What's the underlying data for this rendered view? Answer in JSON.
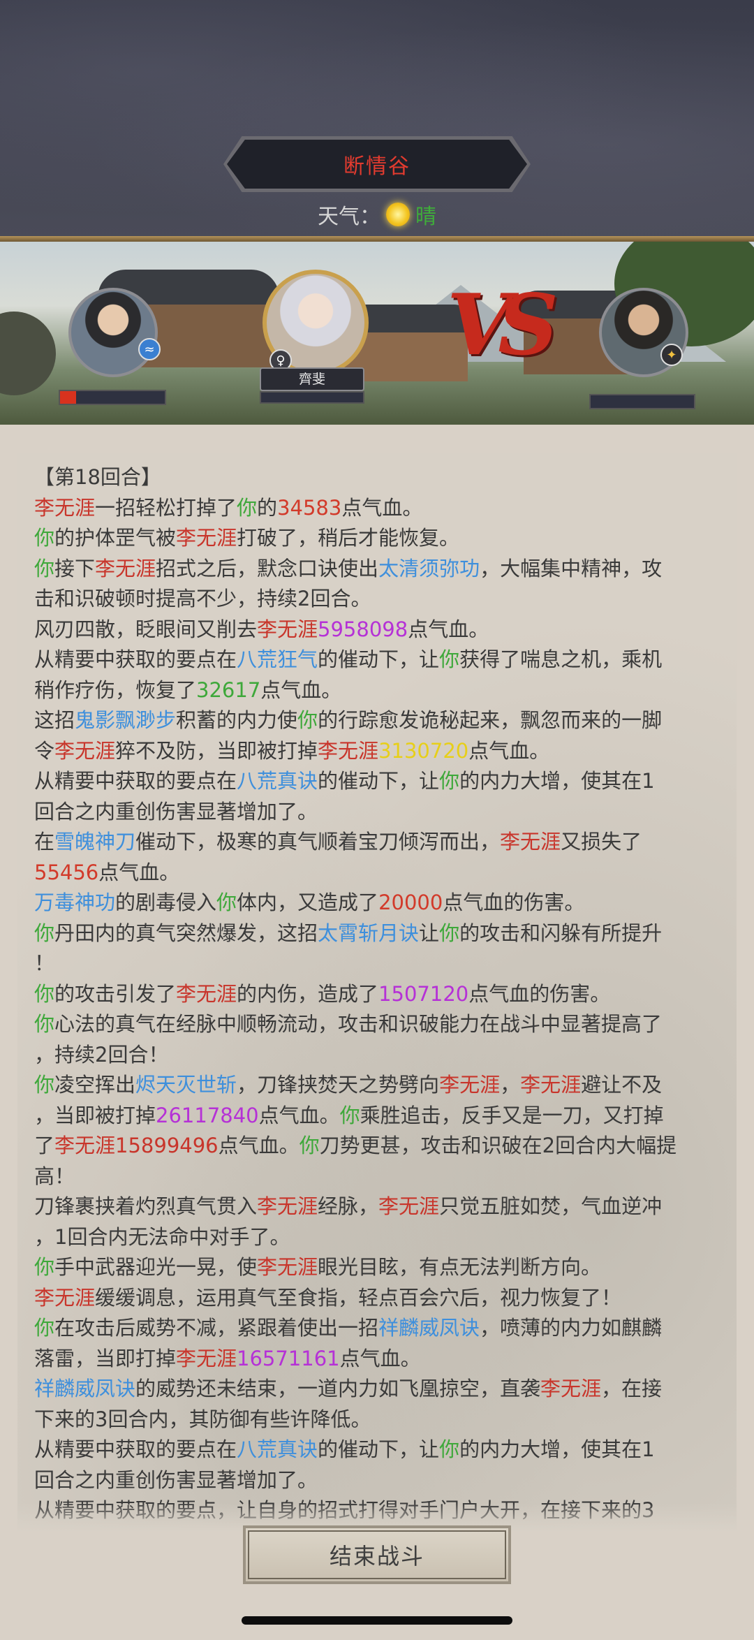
{
  "header": {
    "location_title": "断情谷",
    "weather_label": "天气：",
    "weather_icon": "sun-icon",
    "weather_value": "晴"
  },
  "battle": {
    "ally_name": "齊斐",
    "player_hp_fraction": 0.15,
    "ally_hp_fraction": 0.0,
    "enemy_hp_fraction": 0.0,
    "vs_text": "VS"
  },
  "colors": {
    "enemy": "#c8352b",
    "self": "#3ea83a",
    "skill": "#3e8fdc",
    "num_yellow": "#e7cf19",
    "num_purple": "#b531d6"
  },
  "log": [
    [
      [
        "default",
        "【第18回合】"
      ]
    ],
    [
      [
        "enemy",
        "李无涯"
      ],
      [
        "default",
        "一招轻松打掉了"
      ],
      [
        "self",
        "你"
      ],
      [
        "default",
        "的"
      ],
      [
        "num-red",
        "34583"
      ],
      [
        "default",
        "点气血。"
      ]
    ],
    [
      [
        "self",
        "你"
      ],
      [
        "default",
        "的护体罡气被"
      ],
      [
        "enemy",
        "李无涯"
      ],
      [
        "default",
        "打破了，稍后才能恢复。"
      ]
    ],
    [
      [
        "self",
        "你"
      ],
      [
        "default",
        "接下"
      ],
      [
        "enemy",
        "李无涯"
      ],
      [
        "default",
        "招式之后，默念口诀使出"
      ],
      [
        "skill",
        "太清须弥功"
      ],
      [
        "default",
        "，大幅集中精神，攻"
      ]
    ],
    [
      [
        "default",
        "击和识破顿时提高不少，持续2回合。"
      ]
    ],
    [
      [
        "default",
        "风刃四散，眨眼间又削去"
      ],
      [
        "enemy",
        "李无涯"
      ],
      [
        "num-purple",
        "5958098"
      ],
      [
        "default",
        "点气血。"
      ]
    ],
    [
      [
        "default",
        "从精要中获取的要点在"
      ],
      [
        "skill",
        "八荒狂气"
      ],
      [
        "default",
        "的催动下，让"
      ],
      [
        "self",
        "你"
      ],
      [
        "default",
        "获得了喘息之机，乘机"
      ]
    ],
    [
      [
        "default",
        "稍作疗伤，恢复了"
      ],
      [
        "num-green",
        "32617"
      ],
      [
        "default",
        "点气血。"
      ]
    ],
    [
      [
        "default",
        "这招"
      ],
      [
        "skill",
        "鬼影飘渺步"
      ],
      [
        "default",
        "积蓄的内力使"
      ],
      [
        "self",
        "你"
      ],
      [
        "default",
        "的行踪愈发诡秘起来，飘忽而来的一脚"
      ]
    ],
    [
      [
        "default",
        "令"
      ],
      [
        "enemy",
        "李无涯"
      ],
      [
        "default",
        "猝不及防，当即被打掉"
      ],
      [
        "enemy",
        "李无涯"
      ],
      [
        "num-yellow",
        "3130720"
      ],
      [
        "default",
        "点气血。"
      ]
    ],
    [
      [
        "default",
        "从精要中获取的要点在"
      ],
      [
        "skill",
        "八荒真诀"
      ],
      [
        "default",
        "的催动下，让"
      ],
      [
        "self",
        "你"
      ],
      [
        "default",
        "的内力大增，使其在1"
      ]
    ],
    [
      [
        "default",
        "回合之内重创伤害显著增加了。"
      ]
    ],
    [
      [
        "default",
        "在"
      ],
      [
        "skill",
        "雪魄神刀"
      ],
      [
        "default",
        "催动下，极寒的真气顺着宝刀倾泻而出，"
      ],
      [
        "enemy",
        "李无涯"
      ],
      [
        "default",
        "又损失了"
      ]
    ],
    [
      [
        "num-red",
        "55456"
      ],
      [
        "default",
        "点气血。"
      ]
    ],
    [
      [
        "skill",
        "万毒神功"
      ],
      [
        "default",
        "的剧毒侵入"
      ],
      [
        "self",
        "你"
      ],
      [
        "default",
        "体内，又造成了"
      ],
      [
        "num-red",
        "20000"
      ],
      [
        "default",
        "点气血的伤害。"
      ]
    ],
    [
      [
        "self",
        "你"
      ],
      [
        "default",
        "丹田内的真气突然爆发，这招"
      ],
      [
        "skill",
        "太霄斩月诀"
      ],
      [
        "default",
        "让"
      ],
      [
        "self",
        "你"
      ],
      [
        "default",
        "的攻击和闪躲有所提升"
      ]
    ],
    [
      [
        "default",
        "！"
      ]
    ],
    [
      [
        "self",
        "你"
      ],
      [
        "default",
        "的攻击引发了"
      ],
      [
        "enemy",
        "李无涯"
      ],
      [
        "default",
        "的内伤，造成了"
      ],
      [
        "num-purple",
        "1507120"
      ],
      [
        "default",
        "点气血的伤害。"
      ]
    ],
    [
      [
        "self",
        "你"
      ],
      [
        "default",
        "心法的真气在经脉中顺畅流动，攻击和识破能力在战斗中显著提高了"
      ]
    ],
    [
      [
        "default",
        "，持续2回合！"
      ]
    ],
    [
      [
        "self",
        "你"
      ],
      [
        "default",
        "凌空挥出"
      ],
      [
        "skill",
        "烬天灭世斩"
      ],
      [
        "default",
        "，刀锋挟焚天之势劈向"
      ],
      [
        "enemy",
        "李无涯"
      ],
      [
        "default",
        "，"
      ],
      [
        "enemy",
        "李无涯"
      ],
      [
        "default",
        "避让不及"
      ]
    ],
    [
      [
        "default",
        "，当即被打掉"
      ],
      [
        "num-purple",
        "26117840"
      ],
      [
        "default",
        "点气血。"
      ],
      [
        "self",
        "你"
      ],
      [
        "default",
        "乘胜追击，反手又是一刀，又打掉"
      ]
    ],
    [
      [
        "default",
        "了"
      ],
      [
        "enemy",
        "李无涯15899496"
      ],
      [
        "default",
        "点气血。"
      ],
      [
        "self",
        "你"
      ],
      [
        "default",
        "刀势更甚，攻击和识破在2回合内大幅提"
      ]
    ],
    [
      [
        "default",
        "高！"
      ]
    ],
    [
      [
        "default",
        "刀锋裹挟着灼烈真气贯入"
      ],
      [
        "enemy",
        "李无涯"
      ],
      [
        "default",
        "经脉，"
      ],
      [
        "enemy",
        "李无涯"
      ],
      [
        "default",
        "只觉五脏如焚，气血逆冲"
      ]
    ],
    [
      [
        "default",
        "，1回合内无法命中对手了。"
      ]
    ],
    [
      [
        "self",
        "你"
      ],
      [
        "default",
        "手中武器迎光一晃，使"
      ],
      [
        "enemy",
        "李无涯"
      ],
      [
        "default",
        "眼光目眩，有点无法判断方向。"
      ]
    ],
    [
      [
        "enemy",
        "李无涯"
      ],
      [
        "default",
        "缓缓调息，运用真气至食指，轻点百会穴后，视力恢复了！"
      ]
    ],
    [
      [
        "self",
        "你"
      ],
      [
        "default",
        "在攻击后威势不减，紧跟着使出一招"
      ],
      [
        "skill",
        "祥麟威凤诀"
      ],
      [
        "default",
        "，喷薄的内力如麒麟"
      ]
    ],
    [
      [
        "default",
        "落雷，当即打掉"
      ],
      [
        "enemy",
        "李无涯"
      ],
      [
        "num-purple",
        "16571161"
      ],
      [
        "default",
        "点气血。"
      ]
    ],
    [
      [
        "skill",
        "祥麟威凤诀"
      ],
      [
        "default",
        "的威势还未结束，一道内力如飞凰掠空，直袭"
      ],
      [
        "enemy",
        "李无涯"
      ],
      [
        "default",
        "，在接"
      ]
    ],
    [
      [
        "default",
        "下来的3回合内，其防御有些许降低。"
      ]
    ],
    [
      [
        "default",
        "从精要中获取的要点在"
      ],
      [
        "skill",
        "八荒真诀"
      ],
      [
        "default",
        "的催动下，让"
      ],
      [
        "self",
        "你"
      ],
      [
        "default",
        "的内力大增，使其在1"
      ]
    ],
    [
      [
        "default",
        "回合之内重创伤害显著增加了。"
      ]
    ],
    [
      [
        "default",
        "从精要中获取的要点，让自身的招式打得对手门户大开，在接下来的3"
      ]
    ]
  ],
  "footer": {
    "end_button_label": "结束战斗"
  }
}
